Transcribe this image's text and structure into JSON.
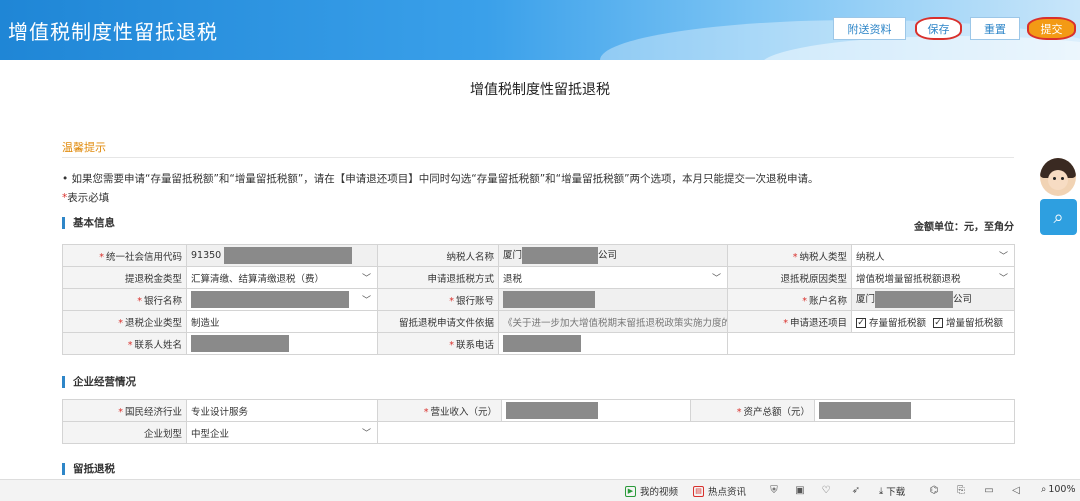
{
  "header": {
    "title": "增值税制度性留抵退税",
    "buttons": {
      "attach": "附送资料",
      "save": "保存",
      "reset": "重置",
      "submit": "提交"
    }
  },
  "page_title": "增值税制度性留抵退税",
  "tips": {
    "heading": "温馨提示",
    "text": "• 如果您需要申请“存量留抵税额”和“增量留抵税额”，请在【申请退还项目】中同时勾选“存量留抵税额”和“增量留抵税额”两个选项，本月只能提交一次退税申请。",
    "required_star": "*",
    "required_text": "表示必填"
  },
  "basic": {
    "heading": "基本信息",
    "amount_unit": "金额单位：元，至角分",
    "rows": [
      {
        "c1_label": "统一社会信用代码",
        "c1_value": "91350",
        "c2_label": "纳税人名称",
        "c2_prefix": "厦门",
        "c2_suffix": "公司",
        "c3_label": "纳税人类型",
        "c3_value": "纳税人"
      },
      {
        "c1_label": "提退税金类型",
        "c1_value": "汇算清缴、结算清缴退税（费）",
        "c2_label": "申请退抵税方式",
        "c2_value": "退税",
        "c3_label": "退抵税原因类型",
        "c3_value": "增值税增量留抵税额退税"
      },
      {
        "c1_label": "银行名称",
        "c2_label": "银行账号",
        "c3_label": "账户名称",
        "c3_prefix": "厦门",
        "c3_suffix": "公司"
      },
      {
        "c1_label": "退税企业类型",
        "c1_value": "制造业",
        "c2_label": "留抵退税申请文件依据",
        "c2_value": "《关于进一步加大增值税期末留抵退税政策实施力度的",
        "c3_label": "申请退还项目",
        "c3_opt1": "存量留抵税额",
        "c3_opt2": "增量留抵税额"
      },
      {
        "c1_label": "联系人姓名",
        "c2_label": "联系电话"
      }
    ]
  },
  "ops": {
    "heading": "企业经营情况",
    "r1": {
      "c1_label": "国民经济行业",
      "c1_value": "专业设计服务",
      "c2_label": "营业收入（元）",
      "c3_label": "资产总额（元）"
    },
    "r2": {
      "c1_label": "企业划型",
      "c1_value": "中型企业"
    }
  },
  "refund": {
    "heading": "留抵退税"
  },
  "statusbar": {
    "video": "我的视频",
    "news": "热点资讯",
    "download": "下载",
    "zoom": "100%"
  },
  "colors": {
    "header_blue": "#1f86d6",
    "submit_orange": "#f39a15",
    "highlight_red": "#d9302c",
    "tip_orange": "#e08a0b"
  }
}
